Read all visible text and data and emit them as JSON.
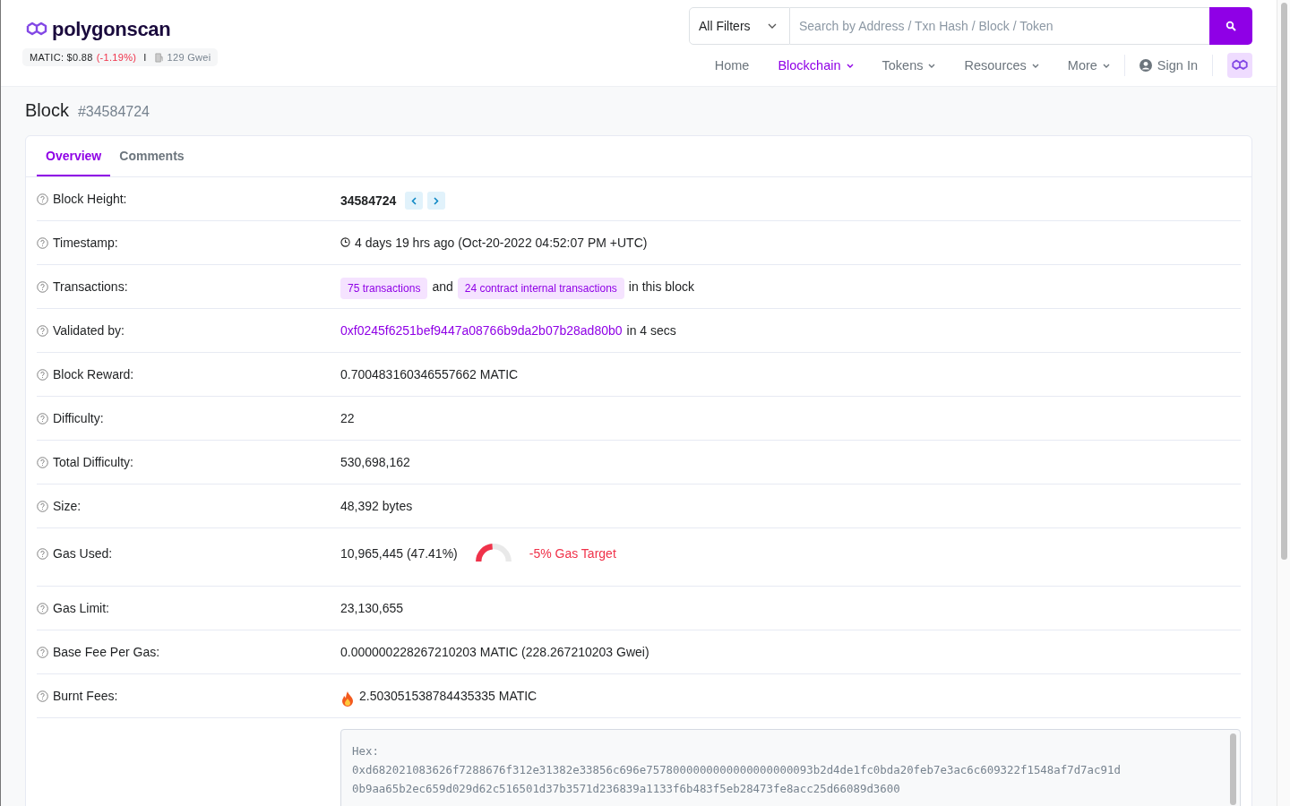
{
  "logo": {
    "text": "polygonscan"
  },
  "price": {
    "label": "MATIC: $0.88",
    "change": "(-1.19%)",
    "separator": "I",
    "gas": "129 Gwei"
  },
  "search": {
    "filter": "All Filters",
    "placeholder": "Search by Address / Txn Hash / Block / Token"
  },
  "nav": [
    {
      "label": "Home",
      "selected": false,
      "dropdown": false
    },
    {
      "label": "Blockchain",
      "selected": true,
      "dropdown": true
    },
    {
      "label": "Tokens",
      "selected": false,
      "dropdown": true
    },
    {
      "label": "Resources",
      "selected": false,
      "dropdown": true
    },
    {
      "label": "More",
      "selected": false,
      "dropdown": true
    }
  ],
  "sign_in": "Sign In",
  "page": {
    "title": "Block",
    "subtitle": "#34584724"
  },
  "tabs": [
    {
      "label": "Overview",
      "selected": true
    },
    {
      "label": "Comments",
      "selected": false
    }
  ],
  "rows": [
    {
      "kind": "height",
      "label": "Block Height:",
      "value": "34584724"
    },
    {
      "kind": "timestamp",
      "label": "Timestamp:",
      "value": "4 days 19 hrs ago (Oct-20-2022 04:52:07 PM +UTC)"
    },
    {
      "kind": "transactions",
      "label": "Transactions:",
      "link1": "75 transactions",
      "middle": "and",
      "link2": "24 contract internal transactions",
      "suffix": "in this block"
    },
    {
      "kind": "validator",
      "label": "Validated by:",
      "link": "0xf0245f6251bef9447a08766b9da2b07b28ad80b0",
      "suffix": "in 4 secs"
    },
    {
      "kind": "text",
      "label": "Block Reward:",
      "value": "0.700483160346557662 MATIC"
    },
    {
      "kind": "text",
      "label": "Difficulty:",
      "value": "22"
    },
    {
      "kind": "text",
      "label": "Total Difficulty:",
      "value": "530,698,162"
    },
    {
      "kind": "text",
      "label": "Size:",
      "value": "48,392 bytes"
    },
    {
      "kind": "gas",
      "label": "Gas Used:",
      "value": "10,965,445 (47.41%)",
      "level": 0.4741,
      "target": "-5% Gas Target"
    },
    {
      "kind": "text",
      "label": "Gas Limit:",
      "value": "23,130,655"
    },
    {
      "kind": "text",
      "label": "Base Fee Per Gas:",
      "value": "0.000000228267210203 MATIC (228.267210203 Gwei)"
    },
    {
      "kind": "burnt",
      "label": "Burnt Fees:",
      "value": "2.503051538784435335 MATIC"
    },
    {
      "kind": "hex",
      "lines": [
        "Hex:",
        "0xd682021083626f7288676f312e31382e33856c696e7578000000000000000000093b2d4de1fc0bda20feb7e3ac6c609322f1548af7d7ac91d",
        "0b9aa65b2ec659d029d62c516501d37b3571d236839a1133f6b483f5eb28473fe8acc25d66089d3600"
      ]
    }
  ]
}
